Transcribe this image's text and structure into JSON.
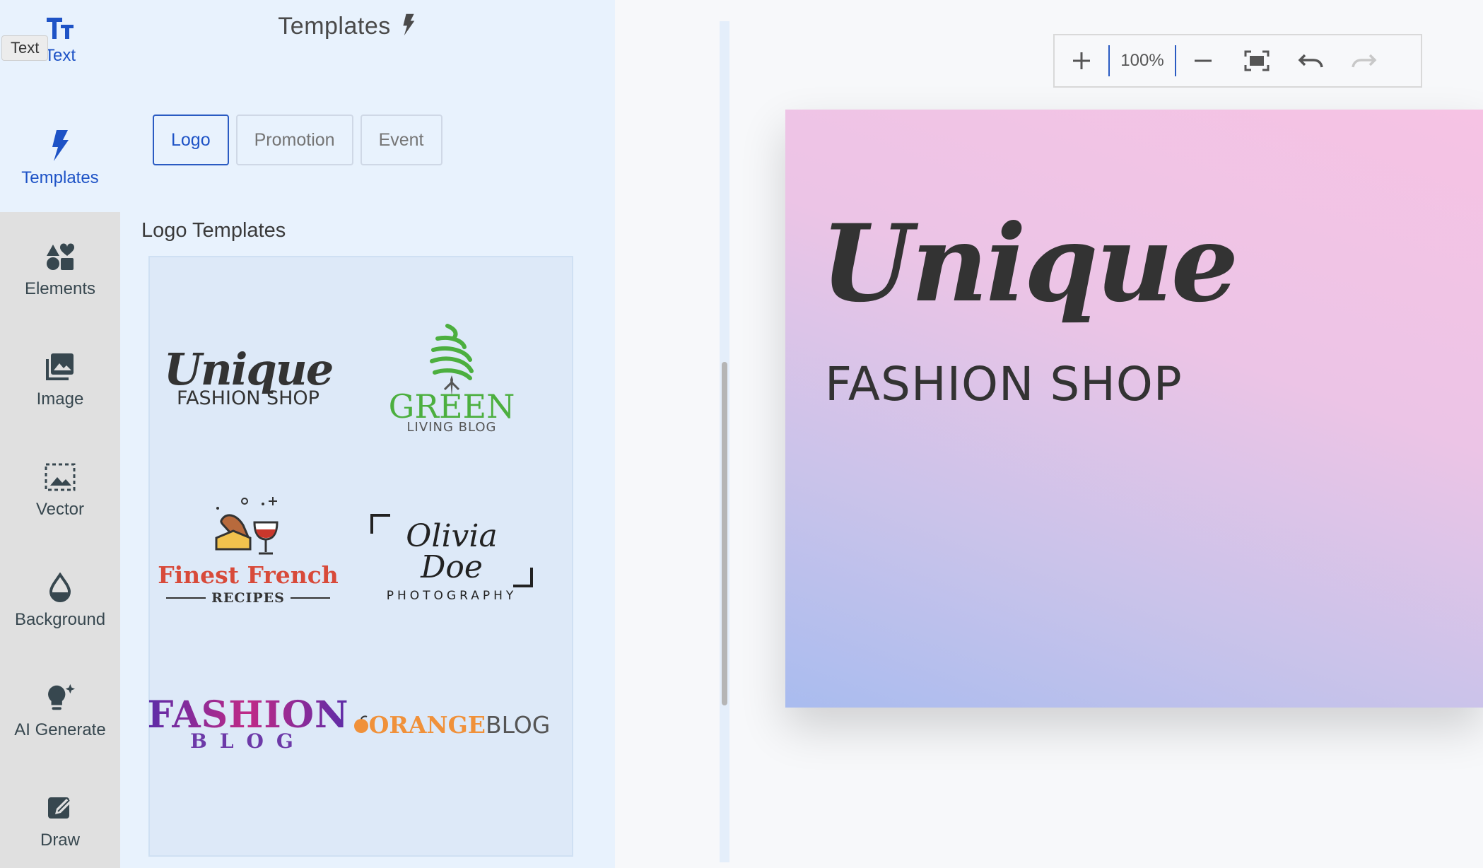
{
  "sidebar": {
    "tooltip": "Text",
    "items": [
      {
        "label": "Text",
        "icon": "text-icon"
      },
      {
        "label": "Templates",
        "icon": "bolt-icon"
      },
      {
        "label": "Elements",
        "icon": "shapes-icon"
      },
      {
        "label": "Image",
        "icon": "image-icon"
      },
      {
        "label": "Vector",
        "icon": "vector-icon"
      },
      {
        "label": "Background",
        "icon": "drop-icon"
      },
      {
        "label": "AI Generate",
        "icon": "lightbulb-sparkle-icon"
      },
      {
        "label": "Draw",
        "icon": "pen-icon"
      }
    ]
  },
  "panel": {
    "title": "Templates",
    "tabs": [
      "Logo",
      "Promotion",
      "Event"
    ],
    "active_tab": "Logo",
    "section_title": "Logo Templates",
    "templates": [
      {
        "line1": "Unique",
        "line2": "FASHION SHOP"
      },
      {
        "line1": "GREEN",
        "line2": "LIVING BLOG"
      },
      {
        "line1": "Finest French",
        "line2": "RECIPES"
      },
      {
        "line1": "Olivia Doe",
        "line2": "PHOTOGRAPHY"
      },
      {
        "line1": "FASHION",
        "line2": "BLOG"
      },
      {
        "line1": "ORANGE",
        "line2": "BLOG"
      }
    ]
  },
  "toolbar": {
    "zoom": "100%"
  },
  "canvas": {
    "script_text": "Unique",
    "sub_text": "FASHION SHOP"
  },
  "colors": {
    "accent": "#1e53c6",
    "panel_bg": "#e8f2fd",
    "rail_bg": "#e0e0e0",
    "green_logo": "#4caf3f",
    "french_red": "#d84a3a",
    "fashion_purple": "#6d3aa8",
    "orange": "#f0913a"
  }
}
